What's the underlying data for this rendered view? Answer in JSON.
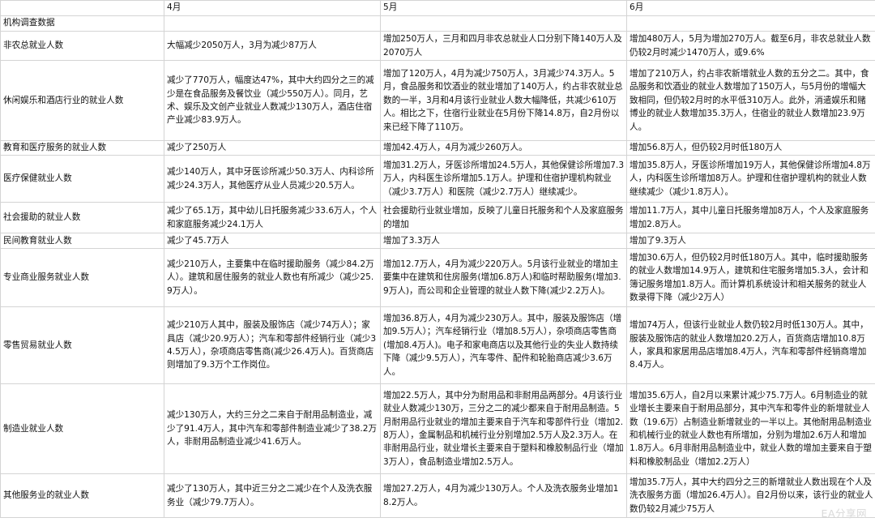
{
  "header": {
    "col_label": "",
    "months": [
      "4月",
      "5月",
      "6月"
    ]
  },
  "section_title": "机构调查数据",
  "rows": [
    {
      "label": "非农总就业人数",
      "apr": "大幅减少2050万人，3月为减少87万人",
      "may": "增加250万人，三月和四月非农总就业人口分别下降140万人及2070万人",
      "jun": "增加480万人，5月为增加270万人。截至6月，非农总就业人数仍较2月时减少1470万人，或9.6%"
    },
    {
      "label": "休闲娱乐和酒店行业的就业人数",
      "apr": "减少了770万人，幅度达47%，其中大约四分之三的减少是在食品服务及餐饮业（减少550万人）。同月，艺术、娱乐及文创产业就业人数减少130万人，酒店住宿产业减少83.9万人。",
      "may": "增加了120万人，4月为减少750万人，3月减少74.3万人。5月，食品服务和饮酒业的就业增加了140万人，约占非农就业总数的一半，3月和4月该行业就业人数大幅降低，共减少610万人。相比之下，住宿行业就业在5月份下降14.8万，自2月份以来已经下降了110万。",
      "jun": "增加了210万人，约占非农新增就业人数的五分之二。其中，食品服务和饮酒业的就业人数增加了150万人，与5月份的增幅大致相同，但仍较2月时的水平低310万人。此外，消遣娱乐和赌博业的就业人数增加35.3万人，住宿业的就业人数增加23.9万人。"
    },
    {
      "label": "教育和医疗服务的就业人数",
      "apr": "减少了250万人",
      "may": "增加42.4万人，4月为减少260万人。",
      "jun": "增加56.8万人，但仍较2月时低180万人"
    },
    {
      "label": "医疗保健就业人数",
      "apr": "减少140万人，其中牙医诊所减少50.3万人、内科诊所减少24.3万人，其他医疗从业人员减少20.5万人。",
      "may": "增加31.2万人，牙医诊所增加24.5万人，其他保健诊所增加7.3万人，内科医生诊所增加5.1万人。护理和住宿护理机构就业（减少3.7万人）和医院（减少2.7万人）继续减少。",
      "jun": "增加35.8万人，牙医诊所增加19万人，其他保健诊所增加4.8万人，内科医生诊所增加8万人。护理和住宿护理机构的就业人数继续减少（减少1.8万人）。"
    },
    {
      "label": "社会援助的就业人数",
      "apr": "减少了65.1万，其中幼儿日托服务减少33.6万人，个人和家庭服务减少24.1万人",
      "may": "社会援助行业就业增加，反映了儿童日托服务和个人及家庭服务的增加",
      "jun": "增加11.7万人，其中儿童日托服务增加8万人，个人及家庭服务增加2.8万人。"
    },
    {
      "label": "民间教育就业人数",
      "apr": "减少了45.7万人",
      "may": "增加了3.3万人",
      "jun": "增加了9.3万人"
    },
    {
      "label": "专业商业服务就业人数",
      "apr": "减少210万人，主要集中在临时援助服务（减少84.2万人）。建筑和居住服务的就业人数也有所减少（减少25.9万人）。",
      "may": "增加12.7万人，4月为减少220万人。5月该行业就业的增加主要集中在建筑和住房服务(增加6.8万人)和临时帮助服务(增加3.9万人)，而公司和企业管理的就业人数下降(减少2.2万人)。",
      "jun": "增加30.6万人，但仍较2月时低180万人。其中，临时援助服务的就业人数增加14.9万人，建筑和住宅服务增加5.3人，会计和簿记服务增加1.8万人。而计算机系统设计和相关服务的就业人数录得下降（减少2万人）"
    },
    {
      "label": "零售贸易就业人数",
      "apr": "减少210万人其中，服装及服饰店（减少74万人）；家具店（减少20.9万人）；汽车和零部件经销行业（减少34.5万人），杂项商店零售商(减少26.4万人)。百货商店则增加了9.3万个工作岗位。",
      "may": "增加36.8万人，4月为减少230万人。其中，服装及服饰店（增加9.5万人）；汽车经销行业（增加8.5万人），杂项商店零售商(增加8.4万人)。电子和家电商店以及其他行业的失业人数持续下降（减少9.5万人），汽车零件、配件和轮胎商店减少3.6万人。",
      "jun": "增加74万人，但该行业就业人数仍较2月时低130万人。其中，服装及服饰店的就业人数增加20.2万人，百货商店增加10.8万人，家具和家居用品店增加8.4万人，汽车和零部件经销商增加8.4万人。"
    },
    {
      "label": "制造业就业人数",
      "apr": "减少130万人，大约三分之二来自于耐用品制造业，减少了91.4万人，其中汽车和零部件制造业减少了38.2万人，非耐用品制造业减少41.6万人。",
      "may": "增加22.5万人，其中分为耐用品和非耐用品两部分。4月该行业就业人数减少130万，三分之二的减少都来自于耐用品制造。5月耐用品行业就业的增加主要来自于汽车和零部件行业（增加2.8万人），金属制品和机械行业分别增加2.5万人及2.3万人。在非耐用品行业，就业增长主要来自于塑料和橡胶制品行业（增加3万人），食品制造业增加2.5万人。",
      "jun": "增加35.6万人，自2月以来累计减少75.7万人。6月制造业的就业增长主要来自于耐用品部分，其中汽车和零件业的新增就业人数（19.6万）占制造业新增就业的一半以上。其他耐用品制造业和机械行业的就业人数也有所增加，分别为增加2.6万人和增加1.8万人。6月非耐用品制造业中，就业人数的增加主要来自于塑料和橡胶制品业（增加2.2万人）"
    },
    {
      "label": "其他服务业的就业人数",
      "apr": "减少了130万人，其中近三分之二减少在个人及洗衣服务业（减少79.7万人）。",
      "may": "增加27.2万人，4月为减少130万人。个人及洗衣服务业增加18.2万人。",
      "jun": "增加35.7万人，其中大约四分之三的新增就业人数出现在个人及洗衣服务方面（增加26.4万人）。自2月份以来，该行业的就业人数仍较2月减少75万人"
    }
  ],
  "watermark": "EA分享网"
}
